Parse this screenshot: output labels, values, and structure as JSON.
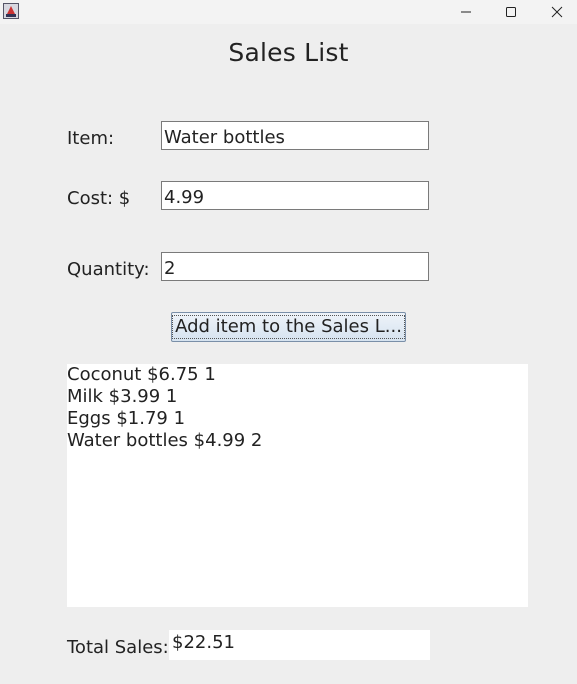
{
  "titlebar": {
    "icons": [
      "java-app-icon",
      "minimize-icon",
      "maximize-icon",
      "close-icon"
    ]
  },
  "heading": "Sales List",
  "form": {
    "item_label": "Item:",
    "item_value": "Water bottles",
    "cost_label": "Cost: $",
    "cost_value": "4.99",
    "quantity_label": "Quantity:",
    "quantity_value": "2"
  },
  "add_button_label": "Add item to the Sales L...",
  "sales_list": [
    "Coconut $6.75 1",
    "Milk $3.99 1",
    "Eggs $1.79 1",
    "Water bottles $4.99 2"
  ],
  "total": {
    "label": "Total Sales:",
    "value": "$22.51"
  }
}
